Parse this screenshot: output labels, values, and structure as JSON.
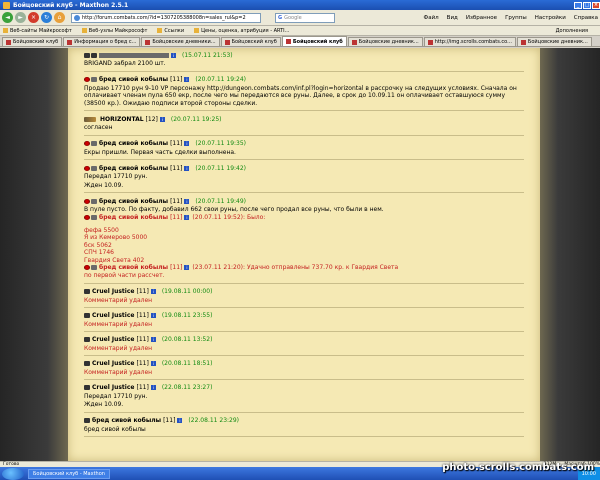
{
  "window": {
    "title": "Бойцовский клуб - Maxthon 2.5.1"
  },
  "toolbar": {
    "url": "http://forum.combats.com/?id=1307205388008n=sales_rul&p=2",
    "search_engine": "G",
    "search_placeholder": "Google",
    "menu": [
      "Файл",
      "Вид",
      "Избранное",
      "Группы",
      "Настройки",
      "Справка"
    ]
  },
  "links": {
    "items": [
      "Веб-сайты Майкрософт",
      "Веб-узлы Майкрософт",
      "Ссылки",
      "Цены, оценка, атрибуция - ARTI..."
    ],
    "addons": "Дополнения"
  },
  "tabs": [
    "Бойцовский клуб",
    "Информация о бред с...",
    "Бойцовские дневники...",
    "Бойцовский клуб",
    "Бойцовский клуб",
    "Бойцовские дневник...",
    "http://img.scrolls.combats.co...",
    "Бойцовские дневник..."
  ],
  "posts": {
    "p0": {
      "text": "BRIGAND забрал 2100 шт.",
      "time": "(15.07.11 21:53)"
    },
    "p1": {
      "name": "бред сивой кобылы",
      "level": "[11]",
      "time": "(20.07.11 19:24)",
      "text": "Продаю 17710 рун 9-10 VP персонажу http://dungeon.combats.com/inf.pl?login=horizontal в рассрочку на следущих условиях. Сначала он оплачивает членам пула 650 екр, после чего мы передаются все руны. Далее, в срок до 10.09.11 он оплачивает оставшуюся сумму (38500 кр.). Ожидаю подписи второй стороны сделки."
    },
    "p2": {
      "name": "HORIZONTAL",
      "level": "[12]",
      "time": "(20.07.11 19:25)",
      "text": "согласен"
    },
    "p3": {
      "name": "бред сивой кобылы",
      "level": "[11]",
      "time": "(20.07.11 19:35)",
      "text": "Екры пришли. Первая часть сделки выполнена."
    },
    "p4": {
      "name": "бред сивой кобылы",
      "level": "[11]",
      "time": "(20.07.11 19:42)",
      "line1": "Передал 17710 рун.",
      "line2": "Жден 10.09."
    },
    "p5": {
      "name": "бред сивой кобылы",
      "level": "[11]",
      "time": "(20.07.11 19:49)",
      "text": "В пуле пусто. По факту, добавил 662 свои руны, после чего продал все руны, что были в нем.",
      "q1_name": "бред сивой кобылы",
      "q1_level": "[11]",
      "q1_time": "(20.07.11 19:52): Было:",
      "q1_lines": [
        "фефа 5500",
        "Я из Кемерово 5000",
        "бск 5062",
        "СПЧ 1746",
        "Гвардия Света 402"
      ],
      "q2_name": "бред сивой кобылы",
      "q2_level": "[11]",
      "q2_time": "(23.07.11 21:20): Удачно отправлены 737.70 кр. к Гвардия Света",
      "q2_line": "по первой части рассчет."
    },
    "p6": {
      "name": "Cruel Justice",
      "level": "[11]",
      "time": "(19.08.11 00:00)",
      "text": "Комментарий удален"
    },
    "p7": {
      "name": "Cruel Justice",
      "level": "[11]",
      "time": "(19.08.11 23:55)",
      "text": "Комментарий удален"
    },
    "p8": {
      "name": "Cruel Justice",
      "level": "[11]",
      "time": "(20.08.11 13:52)",
      "text": "Комментарий удален"
    },
    "p9": {
      "name": "Cruel Justice",
      "level": "[11]",
      "time": "(20.08.11 18:51)",
      "text": "Комментарий удален"
    },
    "p10": {
      "name": "Cruel Justice",
      "level": "[11]",
      "time": "(22.08.11 23:27)",
      "line1": "Передал 17710 рун.",
      "line2": "Жден 10.09."
    },
    "p11": {
      "name": "бред сивой кобылы",
      "level": "[11]",
      "time": "(22.08.11 23:29)",
      "text": "бред сивой кобылы"
    }
  },
  "status": {
    "left": "Готово",
    "memory": "112M",
    "zoom": "Масштаб 100%"
  },
  "taskbar": {
    "item": "Бойцовский клуб - Maxthon",
    "clock": "10:00"
  },
  "watermark": "photo.scrolls.combats.com"
}
